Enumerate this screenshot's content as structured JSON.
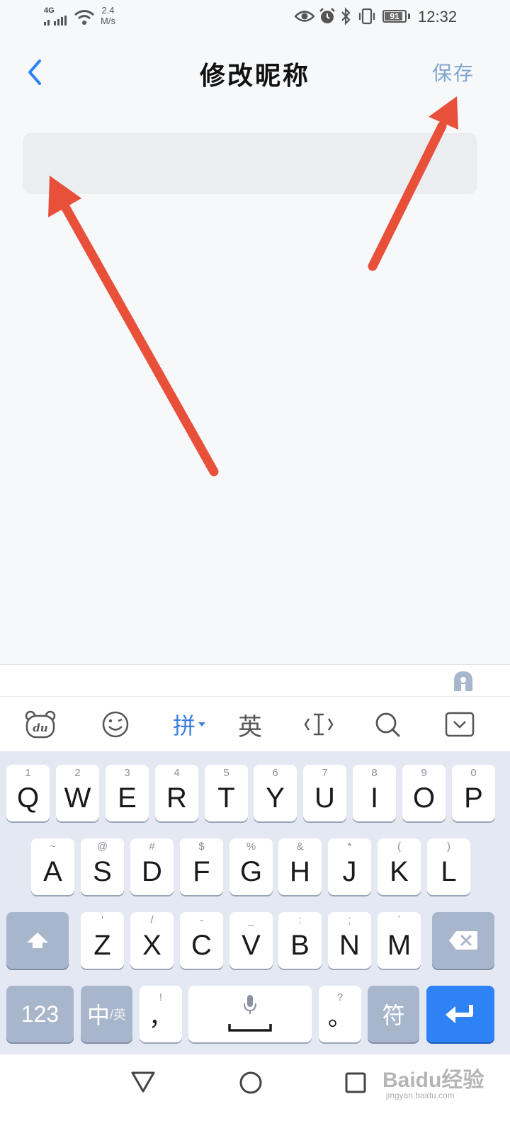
{
  "status_bar": {
    "network": "4G",
    "speed_value": "2.4",
    "speed_unit": "M/s",
    "battery": "91",
    "battery_level_percent": 91,
    "time": "12:32"
  },
  "header": {
    "title": "修改昵称",
    "save_label": "保存"
  },
  "nickname_input": {
    "value": "",
    "placeholder": ""
  },
  "keyboard": {
    "toolbar": {
      "pinyin_label": "拼",
      "english_label": "英"
    },
    "row1": [
      {
        "hint": "1",
        "ch": "Q"
      },
      {
        "hint": "2",
        "ch": "W"
      },
      {
        "hint": "3",
        "ch": "E"
      },
      {
        "hint": "4",
        "ch": "R"
      },
      {
        "hint": "5",
        "ch": "T"
      },
      {
        "hint": "6",
        "ch": "Y"
      },
      {
        "hint": "7",
        "ch": "U"
      },
      {
        "hint": "8",
        "ch": "I"
      },
      {
        "hint": "9",
        "ch": "O"
      },
      {
        "hint": "0",
        "ch": "P"
      }
    ],
    "row2": [
      {
        "hint": "~",
        "ch": "A"
      },
      {
        "hint": "@",
        "ch": "S"
      },
      {
        "hint": "#",
        "ch": "D"
      },
      {
        "hint": "$",
        "ch": "F"
      },
      {
        "hint": "%",
        "ch": "G"
      },
      {
        "hint": "&",
        "ch": "H"
      },
      {
        "hint": "*",
        "ch": "J"
      },
      {
        "hint": "(",
        "ch": "K"
      },
      {
        "hint": ")",
        "ch": "L"
      }
    ],
    "row3": [
      {
        "hint": "'",
        "ch": "Z"
      },
      {
        "hint": "/",
        "ch": "X"
      },
      {
        "hint": "-",
        "ch": "C"
      },
      {
        "hint": "_",
        "ch": "V"
      },
      {
        "hint": ":",
        "ch": "B"
      },
      {
        "hint": ";",
        "ch": "N"
      },
      {
        "hint": "`",
        "ch": "M"
      }
    ],
    "numbers_label": "123",
    "lang_label_main": "中",
    "lang_label_sub": "/英",
    "comma_hint": "!",
    "comma_char": "，",
    "period_hint": "?",
    "period_char": "。",
    "symbols_label": "符"
  },
  "watermark": {
    "text": "Baidu经验",
    "sub": "jingyan.baidu.com"
  },
  "colors": {
    "accent_blue": "#2f82f5",
    "save_text": "#7ea6cf",
    "arrow_red": "#e8503a",
    "keyboard_bg": "#e3e8f2",
    "function_key": "#a8b6cc"
  }
}
